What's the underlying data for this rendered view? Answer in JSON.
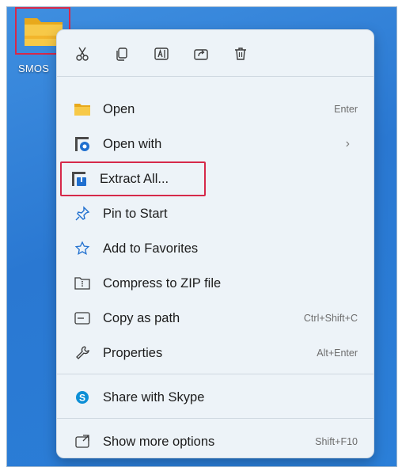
{
  "desktop": {
    "folder_label": "SMOS"
  },
  "quick_actions": [
    {
      "name": "cut-icon"
    },
    {
      "name": "copy-icon"
    },
    {
      "name": "rename-icon"
    },
    {
      "name": "share-icon"
    },
    {
      "name": "delete-icon"
    }
  ],
  "menu": {
    "open": {
      "label": "Open",
      "shortcut": "Enter"
    },
    "open_with": {
      "label": "Open with",
      "chevron": "›"
    },
    "extract_all": {
      "label": "Extract All..."
    },
    "pin_to_start": {
      "label": "Pin to Start"
    },
    "add_to_favorites": {
      "label": "Add to Favorites"
    },
    "compress_zip": {
      "label": "Compress to ZIP file"
    },
    "copy_as_path": {
      "label": "Copy as path",
      "shortcut": "Ctrl+Shift+C"
    },
    "properties": {
      "label": "Properties",
      "shortcut": "Alt+Enter"
    },
    "share_skype": {
      "label": "Share with Skype"
    },
    "show_more": {
      "label": "Show more options",
      "shortcut": "Shift+F10"
    }
  },
  "colors": {
    "highlight": "#d6294a",
    "desktop_blue": "#2a78d2",
    "menu_bg": "#edf3f8",
    "icon_blue": "#1f6fcf",
    "skype_blue": "#0d8fd6"
  }
}
